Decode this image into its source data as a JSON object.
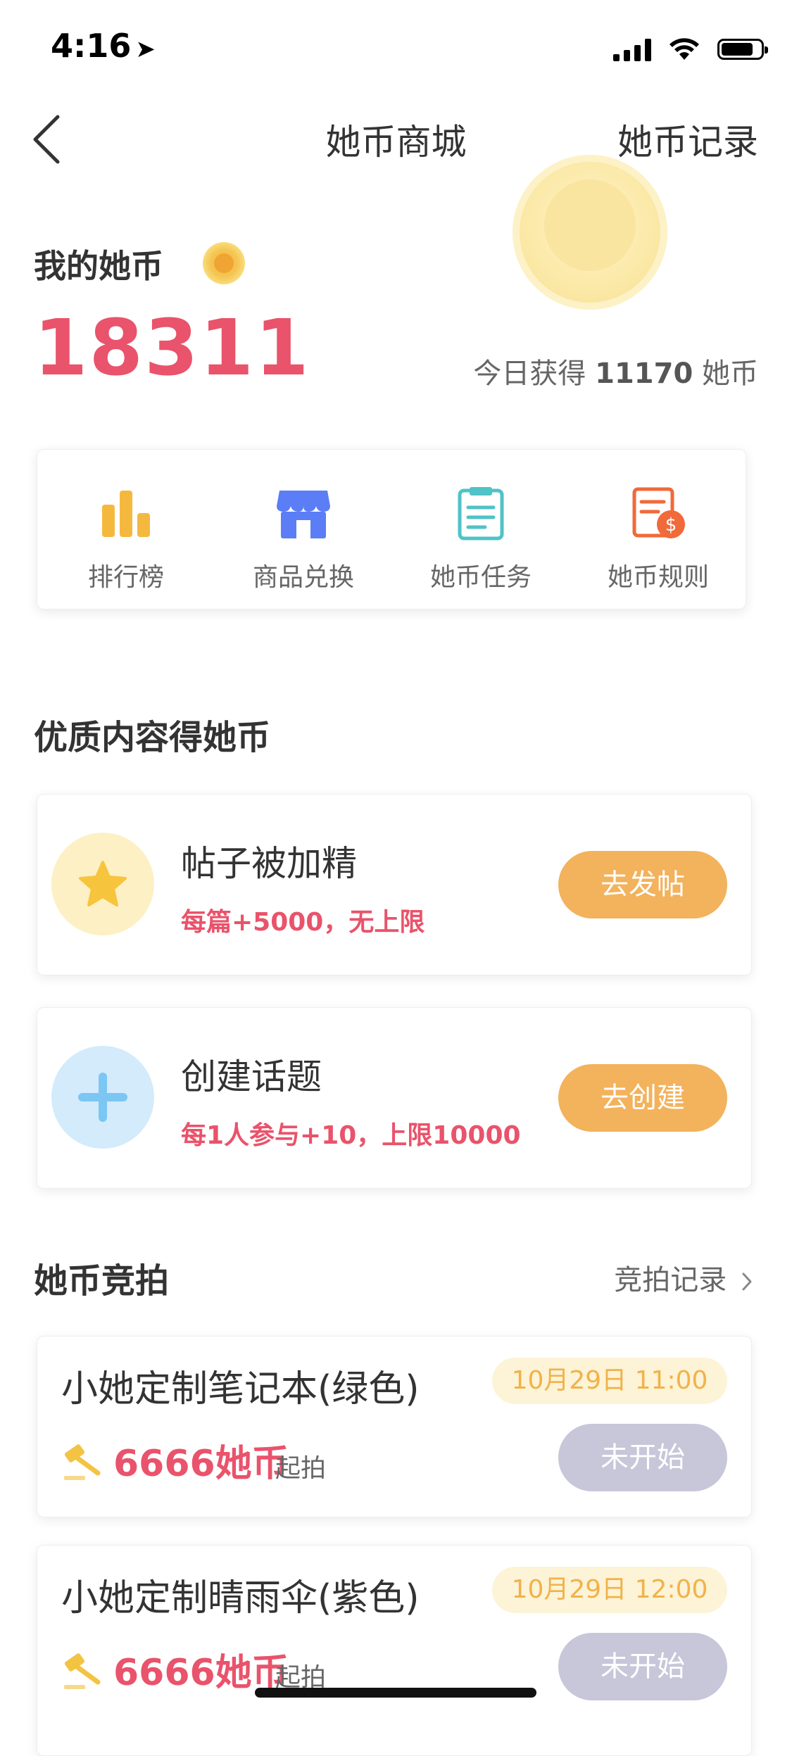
{
  "status_bar": {
    "time": "4:16",
    "location_glyph": "➤"
  },
  "nav": {
    "back_icon": "chevron-left-icon",
    "title": "她币商城",
    "right_link": "她币记录"
  },
  "header": {
    "my_coins_label": "我的她币",
    "balance": "18311",
    "today_prefix": "今日获得",
    "today_amount": "11170",
    "today_suffix": "她币"
  },
  "menu": [
    {
      "label": "排行榜",
      "icon": "bar-chart-icon",
      "color": "#f5b83f"
    },
    {
      "label": "商品兑换",
      "icon": "store-icon",
      "color": "#5b7ef6"
    },
    {
      "label": "她币任务",
      "icon": "clipboard-icon",
      "color": "#4fc3c6"
    },
    {
      "label": "她币规则",
      "icon": "rules-document-icon",
      "color": "#f06a3a"
    }
  ],
  "quality_section": {
    "title": "优质内容得她币",
    "tasks": [
      {
        "title": "帖子被加精",
        "subtitle": "每篇+5000，无上限",
        "button": "去发帖",
        "icon": "star-icon",
        "icon_bg": "#fdf0c4",
        "icon_color": "#f7c43e"
      },
      {
        "title": "创建话题",
        "subtitle": "每1人参与+10，上限10000",
        "button": "去创建",
        "icon": "plus-icon",
        "icon_bg": "#d3ebfb",
        "icon_color": "#7cc6f4"
      }
    ]
  },
  "auction_section": {
    "title": "她币竞拍",
    "records_link": "竞拍记录",
    "items": [
      {
        "title": "小她定制笔记本(绿色)",
        "date": "10月29日 11:00",
        "price": "6666她币",
        "start_label": "起拍",
        "button": "未开始"
      },
      {
        "title": "小她定制晴雨伞(紫色)",
        "date": "10月29日 12:00",
        "price": "6666她币",
        "start_label": "起拍",
        "button": "未开始"
      }
    ]
  }
}
